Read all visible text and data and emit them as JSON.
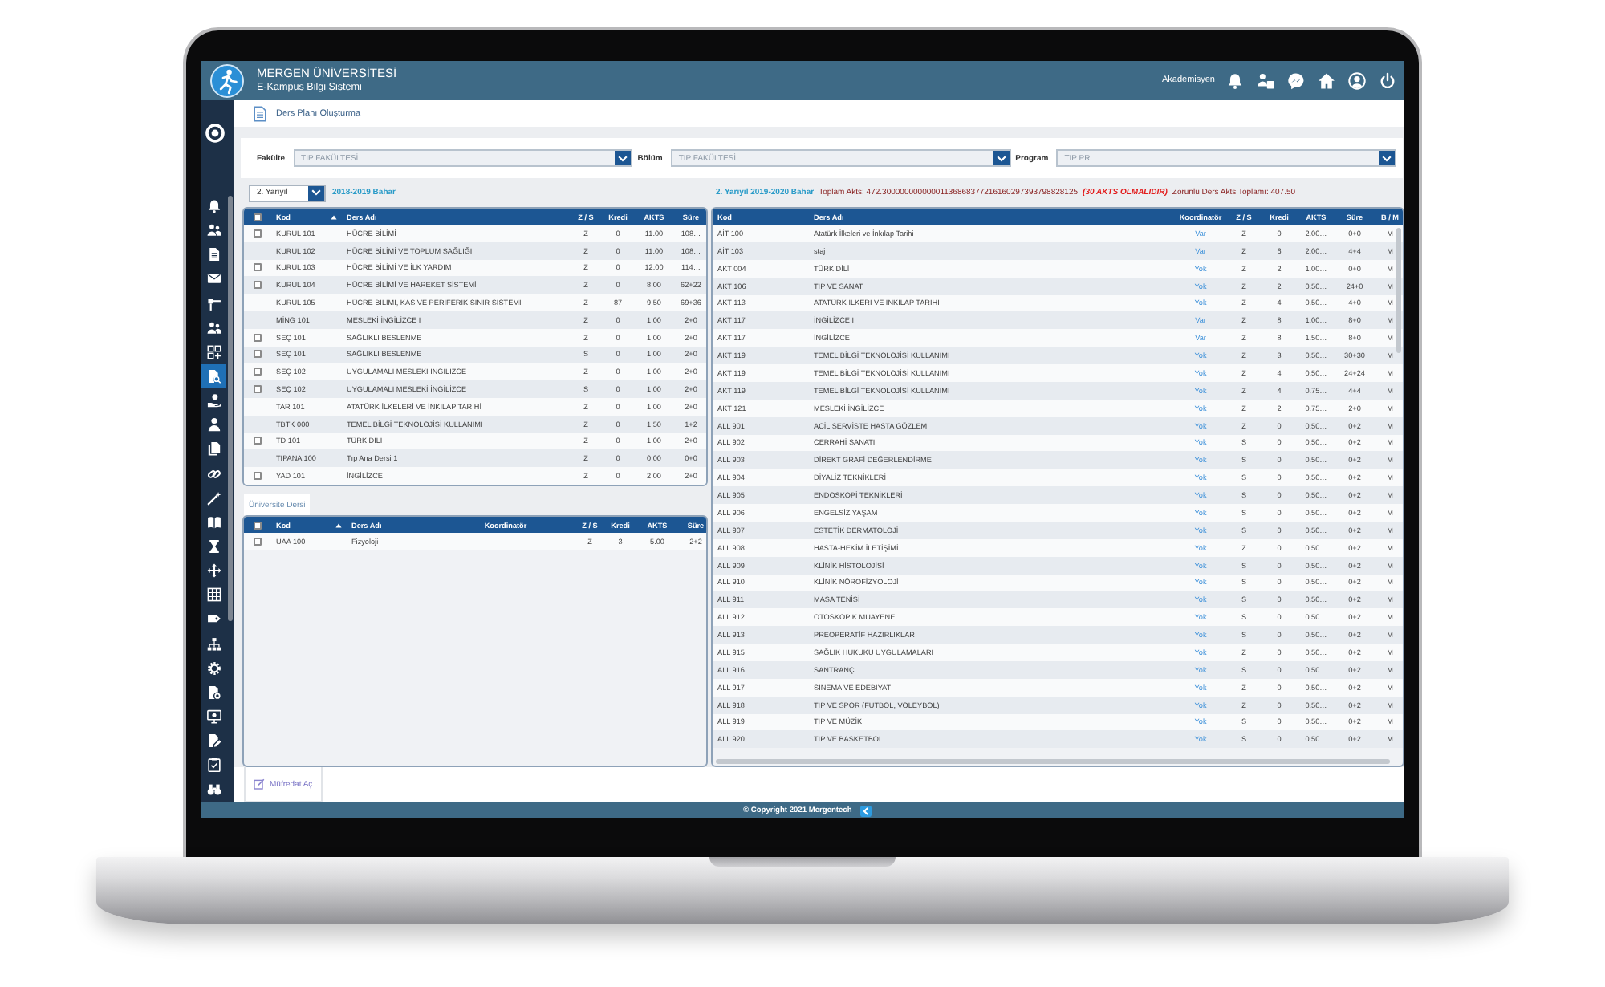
{
  "header": {
    "title": "MERGEN ÜNİVERSİTESİ",
    "subtitle": "E-Kampus Bilgi Sistemi",
    "role": "Akademisyen"
  },
  "sidebar": {
    "items": [
      {
        "selected": false
      },
      {
        "selected": false
      },
      {
        "selected": false
      },
      {
        "selected": false
      },
      {
        "selected": false
      },
      {
        "selected": false
      },
      {
        "selected": false
      },
      {
        "selected": true
      },
      {
        "selected": false
      },
      {
        "selected": false
      },
      {
        "selected": false
      },
      {
        "selected": false
      },
      {
        "selected": false
      },
      {
        "selected": false
      },
      {
        "selected": false
      },
      {
        "selected": false
      },
      {
        "selected": false
      },
      {
        "selected": false
      },
      {
        "selected": false
      },
      {
        "selected": false
      },
      {
        "selected": false
      },
      {
        "selected": false
      },
      {
        "selected": false
      },
      {
        "selected": false
      },
      {
        "selected": false
      }
    ]
  },
  "breadcrumb": {
    "title": "Ders Planı Oluşturma"
  },
  "filters": [
    {
      "label": "Fakülte",
      "value": "TIP FAKÜLTESİ",
      "disabled": true
    },
    {
      "label": "Bölüm",
      "value": "TIP FAKÜLTESİ",
      "disabled": true
    },
    {
      "label": "Program",
      "value": "TIP PR.",
      "disabled": true
    }
  ],
  "left_panel": {
    "semester_select": {
      "value": "2. Yarıyıl"
    },
    "term": "2018-2019 Bahar",
    "table": {
      "select_all_checked": false,
      "columns": [
        {
          "label": "Kod",
          "kind": "text",
          "sorted": true
        },
        {
          "label": "Ders Adı",
          "kind": "text",
          "sorted": false
        },
        {
          "label": "Z / S",
          "kind": "value",
          "sorted": false
        },
        {
          "label": "Kredi",
          "kind": "value",
          "sorted": false
        },
        {
          "label": "AKTS",
          "kind": "value",
          "sorted": false
        },
        {
          "label": "Süre",
          "kind": "value",
          "sorted": false
        }
      ],
      "rows": [
        {
          "checked": false,
          "cells": [
            "KURUL 101",
            "HÜCRE BİLİMİ",
            "Z",
            "0",
            "11.00",
            "108…"
          ]
        },
        {
          "checked": null,
          "cells": [
            "KURUL 102",
            "HÜCRE BİLİMİ VE TOPLUM SAĞLIĞI",
            "Z",
            "0",
            "11.00",
            "108…"
          ]
        },
        {
          "checked": false,
          "cells": [
            "KURUL 103",
            "HÜCRE BİLİMİ VE İLK YARDIM",
            "Z",
            "0",
            "12.00",
            "114…"
          ]
        },
        {
          "checked": false,
          "cells": [
            "KURUL 104",
            "HÜCRE BİLİMİ VE HAREKET SİSTEMİ",
            "Z",
            "0",
            "8.00",
            "62+22"
          ]
        },
        {
          "checked": null,
          "cells": [
            "KURUL 105",
            "HÜCRE BİLİMİ, KAS VE PERİFERİK SİNİR SİSTEMİ",
            "Z",
            "87",
            "9.50",
            "69+36"
          ]
        },
        {
          "checked": null,
          "cells": [
            "MİNG 101",
            "MESLEKİ İNGİLİZCE I",
            "Z",
            "0",
            "1.00",
            "2+0"
          ]
        },
        {
          "checked": false,
          "cells": [
            "SEÇ 101",
            "SAĞLIKLI BESLENME",
            "Z",
            "0",
            "1.00",
            "2+0"
          ]
        },
        {
          "checked": false,
          "cells": [
            "SEÇ 101",
            "SAĞLIKLI BESLENME",
            "S",
            "0",
            "1.00",
            "2+0"
          ]
        },
        {
          "checked": false,
          "cells": [
            "SEÇ 102",
            "UYGULAMALI MESLEKİ İNGİLİZCE",
            "Z",
            "0",
            "1.00",
            "2+0"
          ]
        },
        {
          "checked": false,
          "cells": [
            "SEÇ 102",
            "UYGULAMALI MESLEKİ İNGİLİZCE",
            "S",
            "0",
            "1.00",
            "2+0"
          ]
        },
        {
          "checked": null,
          "cells": [
            "TAR 101",
            "ATATÜRK İLKELERİ VE İNKILAP TARİHİ",
            "Z",
            "0",
            "1.00",
            "2+0"
          ]
        },
        {
          "checked": null,
          "cells": [
            "TBTK 000",
            "TEMEL BİLGİ TEKNOLOJİSİ KULLANIMI",
            "Z",
            "0",
            "1.50",
            "1+2"
          ]
        },
        {
          "checked": false,
          "cells": [
            "TD 101",
            "TÜRK DİLİ",
            "Z",
            "0",
            "1.00",
            "2+0"
          ]
        },
        {
          "checked": null,
          "cells": [
            "TIPANA 100",
            "Tıp Ana Dersi 1",
            "Z",
            "0",
            "0.00",
            "0+0"
          ]
        },
        {
          "checked": false,
          "cells": [
            "YAD 101",
            "İNGİLİZCE",
            "Z",
            "0",
            "2.00",
            "2+0"
          ]
        }
      ]
    },
    "university_tab": {
      "label": "Üniversite Dersi",
      "selected": true
    },
    "university_table": {
      "select_all_checked": false,
      "columns": [
        {
          "label": "Kod",
          "kind": "text",
          "sorted": true
        },
        {
          "label": "Ders Adı",
          "kind": "text",
          "sorted": false
        },
        {
          "label": "Koordinatör",
          "kind": "link",
          "sorted": false
        },
        {
          "label": "Z / S",
          "kind": "value",
          "sorted": false
        },
        {
          "label": "Kredi",
          "kind": "value",
          "sorted": false
        },
        {
          "label": "AKTS",
          "kind": "value",
          "sorted": false
        },
        {
          "label": "Süre",
          "kind": "value",
          "sorted": false
        }
      ],
      "rows": [
        {
          "checked": false,
          "cells": [
            "UAA 100",
            "Fizyoloji",
            null,
            "Z",
            "3",
            "5.00",
            "2+2"
          ]
        }
      ]
    },
    "curriculum_button": {
      "label": "Müfredat Aç"
    }
  },
  "right_panel": {
    "semester": "2. Yarıyıl 2019-2020 Bahar",
    "total_akts": "Toplam Akts: 472.30000000000001136868377216160297393798828125",
    "warning": "(30 AKTS OLMALIDIR)",
    "required_akts": "Zorunlu Ders Akts Toplamı: 407.50",
    "table": {
      "columns": [
        {
          "label": "Kod",
          "kind": "text"
        },
        {
          "label": "Ders Adı",
          "kind": "text"
        },
        {
          "label": "Koordinatör",
          "kind": "link"
        },
        {
          "label": "Z / S",
          "kind": "value"
        },
        {
          "label": "Kredi",
          "kind": "value"
        },
        {
          "label": "AKTS",
          "kind": "value"
        },
        {
          "label": "Süre",
          "kind": "value"
        },
        {
          "label": "B / M",
          "kind": "value"
        }
      ],
      "rows": [
        {
          "cells": [
            "AİT 100",
            "Atatürk İlkeleri ve İnkılap Tarihi",
            "Var",
            "Z",
            "0",
            "2.00…",
            "0+0",
            "M"
          ]
        },
        {
          "cells": [
            "AİT 103",
            "staj",
            "Var",
            "Z",
            "6",
            "2.00…",
            "4+4",
            "M"
          ]
        },
        {
          "cells": [
            "AKT 004",
            "TÜRK DİLİ",
            "Yok",
            "Z",
            "2",
            "1.00…",
            "0+0",
            "M"
          ]
        },
        {
          "cells": [
            "AKT 106",
            "TIP VE SANAT",
            "Yok",
            "Z",
            "2",
            "0.50…",
            "24+0",
            "M"
          ]
        },
        {
          "cells": [
            "AKT 113",
            "ATATÜRK İLKERİ VE İNKILAP TARİHİ",
            "Yok",
            "Z",
            "4",
            "0.50…",
            "4+0",
            "M"
          ]
        },
        {
          "cells": [
            "AKT 117",
            "İNGİLİZCE I",
            "Var",
            "Z",
            "8",
            "1.00…",
            "8+0",
            "M"
          ]
        },
        {
          "cells": [
            "AKT 117",
            "İNGİLİZCE",
            "Var",
            "Z",
            "8",
            "1.50…",
            "8+0",
            "M"
          ]
        },
        {
          "cells": [
            "AKT 119",
            "TEMEL BİLGİ TEKNOLOJİSİ KULLANIMI",
            "Yok",
            "Z",
            "3",
            "0.50…",
            "30+30",
            "M"
          ]
        },
        {
          "cells": [
            "AKT 119",
            "TEMEL BİLGİ TEKNOLOJİSİ KULLANIMI",
            "Yok",
            "Z",
            "4",
            "0.50…",
            "24+24",
            "M"
          ]
        },
        {
          "cells": [
            "AKT 119",
            "TEMEL BİLGİ TEKNOLOJİSİ KULLANIMI",
            "Yok",
            "Z",
            "4",
            "0.75…",
            "4+4",
            "M"
          ]
        },
        {
          "cells": [
            "AKT 121",
            "MESLEKİ İNGİLİZCE",
            "Yok",
            "Z",
            "2",
            "0.75…",
            "2+0",
            "M"
          ]
        },
        {
          "cells": [
            "ALL 901",
            "ACİL SERVİSTE HASTA GÖZLEMİ",
            "Yok",
            "Z",
            "0",
            "0.50…",
            "0+2",
            "M"
          ]
        },
        {
          "cells": [
            "ALL 902",
            "CERRAHİ SANATI",
            "Yok",
            "S",
            "0",
            "0.50…",
            "0+2",
            "M"
          ]
        },
        {
          "cells": [
            "ALL 903",
            "DİREKT GRAFİ DEĞERLENDİRME",
            "Yok",
            "S",
            "0",
            "0.50…",
            "0+2",
            "M"
          ]
        },
        {
          "cells": [
            "ALL 904",
            "DİYALİZ TEKNİKLERİ",
            "Yok",
            "S",
            "0",
            "0.50…",
            "0+2",
            "M"
          ]
        },
        {
          "cells": [
            "ALL 905",
            "ENDOSKOPİ TEKNİKLERİ",
            "Yok",
            "S",
            "0",
            "0.50…",
            "0+2",
            "M"
          ]
        },
        {
          "cells": [
            "ALL 906",
            "ENGELSİZ YAŞAM",
            "Yok",
            "S",
            "0",
            "0.50…",
            "0+2",
            "M"
          ]
        },
        {
          "cells": [
            "ALL 907",
            "ESTETİK DERMATOLOJİ",
            "Yok",
            "S",
            "0",
            "0.50…",
            "0+2",
            "M"
          ]
        },
        {
          "cells": [
            "ALL 908",
            "HASTA-HEKİM İLETİŞİMİ",
            "Yok",
            "Z",
            "0",
            "0.50…",
            "0+2",
            "M"
          ]
        },
        {
          "cells": [
            "ALL 909",
            "KLİNİK HİSTOLOJİSİ",
            "Yok",
            "S",
            "0",
            "0.50…",
            "0+2",
            "M"
          ]
        },
        {
          "cells": [
            "ALL 910",
            "KLİNİK NÖROFİZYOLOJİ",
            "Yok",
            "S",
            "0",
            "0.50…",
            "0+2",
            "M"
          ]
        },
        {
          "cells": [
            "ALL 911",
            "MASA TENİSİ",
            "Yok",
            "S",
            "0",
            "0.50…",
            "0+2",
            "M"
          ]
        },
        {
          "cells": [
            "ALL 912",
            "OTOSKOPİK MUAYENE",
            "Yok",
            "S",
            "0",
            "0.50…",
            "0+2",
            "M"
          ]
        },
        {
          "cells": [
            "ALL 913",
            "PREOPERATİF HAZIRLIKLAR",
            "Yok",
            "S",
            "0",
            "0.50…",
            "0+2",
            "M"
          ]
        },
        {
          "cells": [
            "ALL 915",
            "SAĞLIK HUKUKU UYGULAMALARI",
            "Yok",
            "Z",
            "0",
            "0.50…",
            "0+2",
            "M"
          ]
        },
        {
          "cells": [
            "ALL 916",
            "SANTRANÇ",
            "Yok",
            "S",
            "0",
            "0.50…",
            "0+2",
            "M"
          ]
        },
        {
          "cells": [
            "ALL 917",
            "SİNEMA VE EDEBİYAT",
            "Yok",
            "Z",
            "0",
            "0.50…",
            "0+2",
            "M"
          ]
        },
        {
          "cells": [
            "ALL 918",
            "TIP VE SPOR (FUTBOL, VOLEYBOL)",
            "Yok",
            "Z",
            "0",
            "0.50…",
            "0+2",
            "M"
          ]
        },
        {
          "cells": [
            "ALL 919",
            "TIP VE MÜZİK",
            "Yok",
            "S",
            "0",
            "0.50…",
            "0+2",
            "M"
          ]
        },
        {
          "cells": [
            "ALL 920",
            "TIP VE BASKETBOL",
            "Yok",
            "S",
            "0",
            "0.50…",
            "0+2",
            "M"
          ]
        }
      ]
    }
  },
  "footer": {
    "copyright": "© Copyright 2021 Mergentech"
  }
}
